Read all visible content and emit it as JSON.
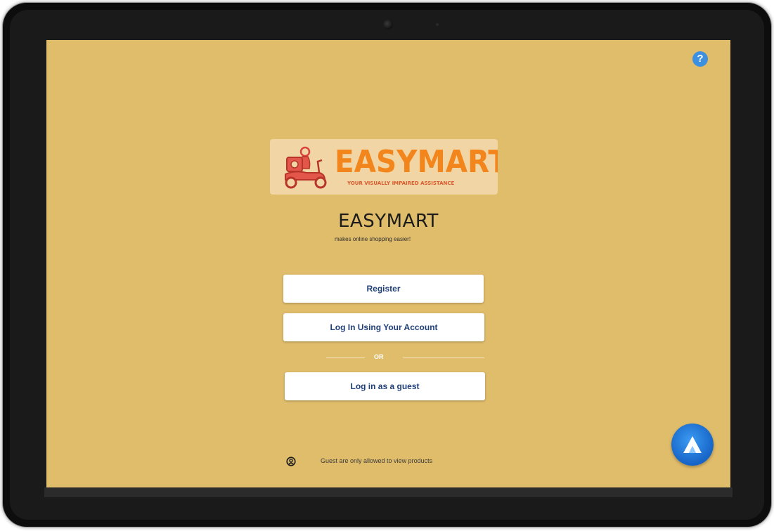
{
  "help": {
    "icon": "question-icon",
    "glyph": "?"
  },
  "logo": {
    "word": "EASYMART",
    "tagline": "YOUR VISUALLY IMPAIRED ASSISTANCE",
    "icon": "delivery-scooter-icon"
  },
  "app": {
    "title": "EASYMART",
    "subtitle": "makes online shopping easier!"
  },
  "buttons": {
    "register": "Register",
    "login": "Log In Using Your Account",
    "divider": "OR",
    "guest": "Log in as a guest"
  },
  "guest_note": {
    "icon": "user-circle-icon",
    "text": "Guest are only allowed to view products"
  },
  "fab": {
    "icon": "assistant-a-icon"
  },
  "colors": {
    "screen_bg": "#e0bd6b",
    "button_text": "#1f3f78",
    "logo_orange": "#f2861c",
    "help_blue": "#3d8fe0",
    "fab_blue": "#1664c7"
  }
}
